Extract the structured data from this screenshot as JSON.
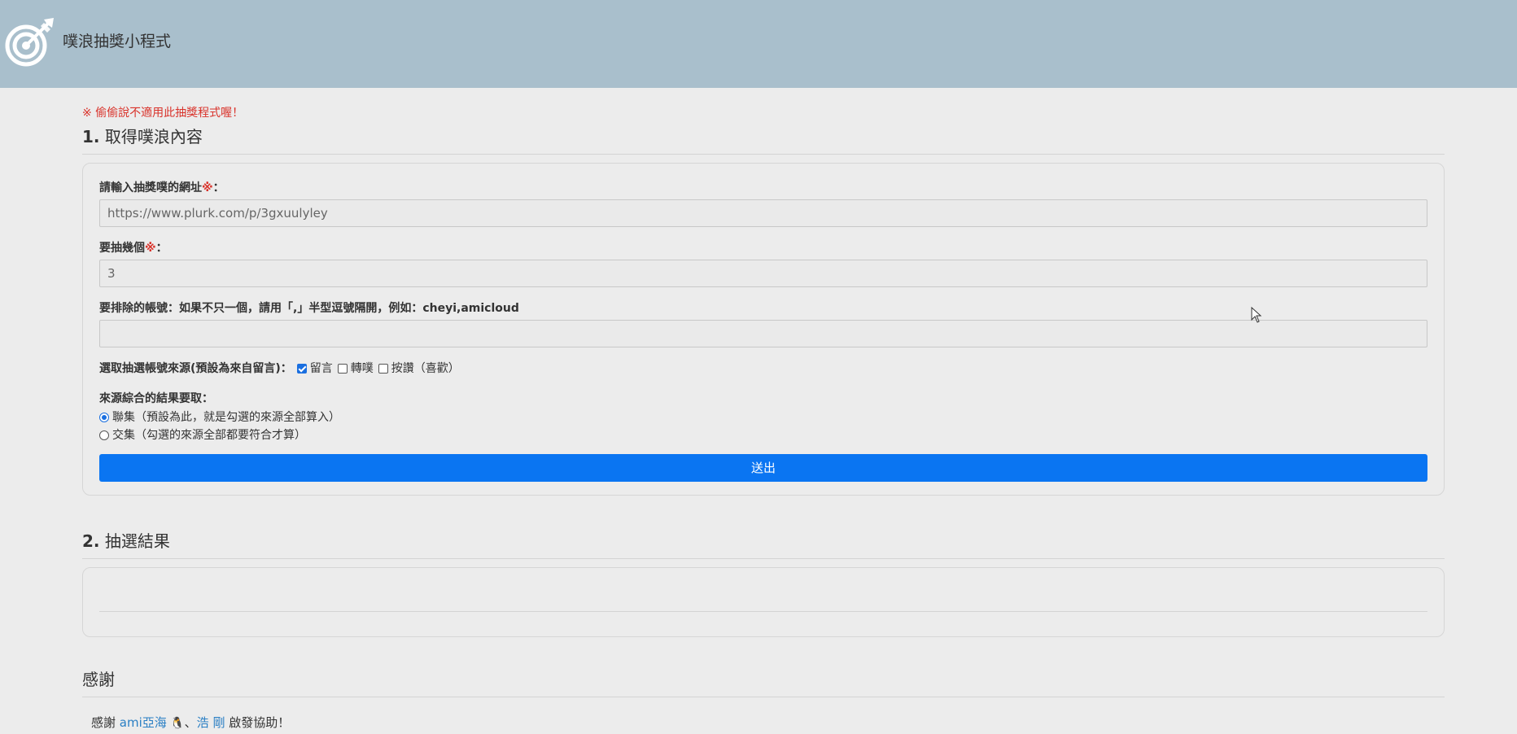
{
  "header": {
    "title": "噗浪抽獎小程式"
  },
  "warning": "※ 偷偷說不適用此抽獎程式喔！",
  "section1": {
    "number": "1.",
    "title": "取得噗浪內容",
    "url_label": "請輸入抽獎噗的網址",
    "required_mark": "※",
    "colon": "：",
    "url_value": "https://www.plurk.com/p/3gxuulyley",
    "count_label": "要抽幾個",
    "count_value": "3",
    "exclude_label_prefix": "要排除的帳號：如果不只一個，請用「,」半型逗號隔開，例如：",
    "exclude_example": "cheyi,amicloud",
    "exclude_value": "",
    "source_label": "選取抽選帳號來源(預設為來自留言)：",
    "sources": [
      {
        "label": "留言",
        "checked": true
      },
      {
        "label": "轉噗",
        "checked": false
      },
      {
        "label": "按讚（喜歡）",
        "checked": false
      }
    ],
    "combine_label": "來源綜合的結果要取：",
    "combine_options": [
      {
        "label": "聯集（預設為此，就是勾選的來源全部算入）",
        "selected": true
      },
      {
        "label": "交集（勾選的來源全部都要符合才算）",
        "selected": false
      }
    ],
    "submit_label": "送出"
  },
  "section2": {
    "number": "2.",
    "title": "抽選結果"
  },
  "thanks": {
    "title": "感謝",
    "prefix": "感謝 ",
    "person1": "ami亞海",
    "separator": "、",
    "person2": "浩 剛",
    "suffix": " 啟發協助！"
  }
}
